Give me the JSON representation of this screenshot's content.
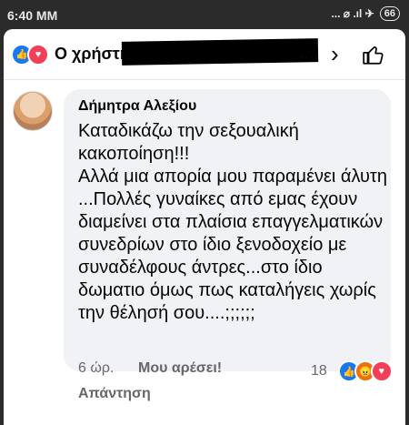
{
  "status": {
    "time": "6:40 MM",
    "signal": "... ⌀ .ıl ✈",
    "battery": "66"
  },
  "header": {
    "title": "Ο χρήστης",
    "ellipsis": "...",
    "chevron": "›"
  },
  "comment": {
    "author": "Δήμητρα Αλεξίου",
    "text": "Καταδικάζω την σεξουαλική κακοποίηση!!!\nΑλλά μια απορία μου παραμένει άλυτη ...Πολλές γυναίκες από εμας έχουν διαμείνει στα πλαίσια επαγγελματικών συνεδρίων στο ίδιο ξενοδοχείο με συναδέλφους άντρες...στο ίδιο δωματιο όμως πως καταλήγεις χωρίς την θέλησή σου....;;;;;;",
    "time": "6 ώρ.",
    "like_label": "Μου αρέσει!",
    "reply_label": "Απάντηση",
    "reaction_count": "18",
    "reactions": [
      "like",
      "angry",
      "love"
    ]
  },
  "colors": {
    "like": "#1877f2",
    "love": "#f33e58",
    "angry": "#e9710f",
    "bubble": "#f0f2f5"
  }
}
